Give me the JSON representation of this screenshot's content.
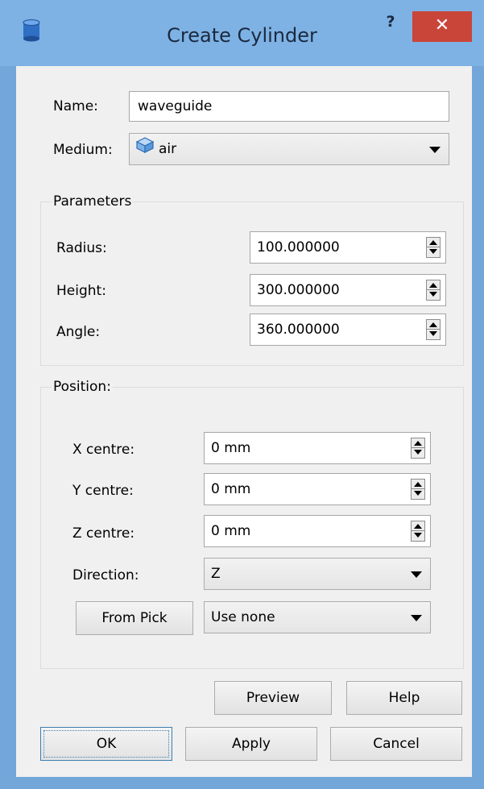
{
  "window": {
    "title": "Create Cylinder",
    "help_label": "?",
    "close_label": "✕",
    "icon": "cylinder-icon"
  },
  "name": {
    "label": "Name:",
    "value": "waveguide"
  },
  "medium": {
    "label": "Medium:",
    "value": "air",
    "icon": "cube-icon"
  },
  "parameters": {
    "title": "Parameters",
    "fields": [
      {
        "label": "Radius:",
        "value": "100.000000"
      },
      {
        "label": "Height:",
        "value": "300.000000"
      },
      {
        "label": "Angle:",
        "value": "360.000000"
      }
    ]
  },
  "position": {
    "title": "Position:",
    "fields": [
      {
        "label": "X centre:",
        "value": "0 mm"
      },
      {
        "label": "Y centre:",
        "value": "0 mm"
      },
      {
        "label": "Z centre:",
        "value": "0 mm"
      }
    ],
    "direction": {
      "label": "Direction:",
      "value": "Z"
    },
    "from_pick_label": "From Pick",
    "pick_mode": "Use none"
  },
  "buttons": {
    "preview": "Preview",
    "help": "Help",
    "ok": "OK",
    "apply": "Apply",
    "cancel": "Cancel"
  },
  "colors": {
    "frame": "#73a6d9",
    "close": "#c9453a"
  }
}
